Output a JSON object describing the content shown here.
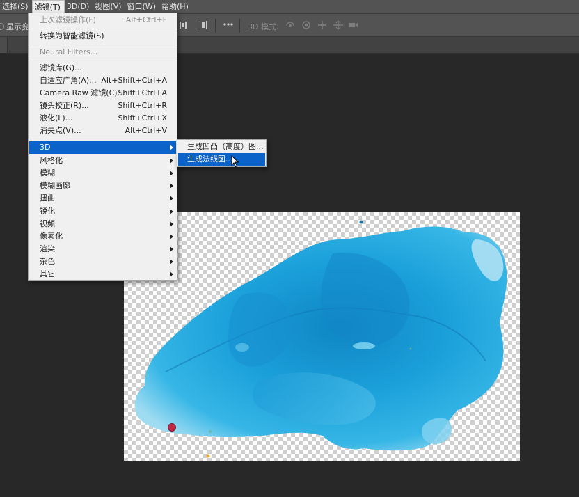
{
  "menubar": {
    "items": [
      {
        "label": "选择(S)"
      },
      {
        "label": "滤镜(T)",
        "active": true
      },
      {
        "label": "3D(D)"
      },
      {
        "label": "视图(V)"
      },
      {
        "label": "窗口(W)"
      },
      {
        "label": "帮助(H)"
      }
    ]
  },
  "options_bar": {
    "show_transform_label": "显示变",
    "mode_label": "3D 模式:",
    "more_icon": "ellipsis-icon",
    "icons": [
      "distribute-icon",
      "align-icon",
      "rotate-3d-icon",
      "roll-3d-icon",
      "drag-3d-icon",
      "slide-3d-icon",
      "scale-3d-icon"
    ]
  },
  "filter_menu": {
    "last_filter": {
      "label": "上次滤镜操作(F)",
      "shortcut": "Alt+Ctrl+F"
    },
    "convert_smart": {
      "label": "转换为智能滤镜(S)"
    },
    "neural": {
      "label": "Neural Filters..."
    },
    "items": [
      {
        "label": "滤镜库(G)...",
        "shortcut": ""
      },
      {
        "label": "自适应广角(A)...",
        "shortcut": "Alt+Shift+Ctrl+A"
      },
      {
        "label": "Camera Raw 滤镜(C)...",
        "shortcut": "Shift+Ctrl+A"
      },
      {
        "label": "镜头校正(R)...",
        "shortcut": "Shift+Ctrl+R"
      },
      {
        "label": "液化(L)...",
        "shortcut": "Shift+Ctrl+X"
      },
      {
        "label": "消失点(V)...",
        "shortcut": "Alt+Ctrl+V"
      }
    ],
    "submenus": [
      {
        "label": "3D",
        "highlighted": true
      },
      {
        "label": "风格化"
      },
      {
        "label": "模糊"
      },
      {
        "label": "模糊画廊"
      },
      {
        "label": "扭曲"
      },
      {
        "label": "锐化"
      },
      {
        "label": "视频"
      },
      {
        "label": "像素化"
      },
      {
        "label": "渲染"
      },
      {
        "label": "杂色"
      },
      {
        "label": "其它"
      }
    ]
  },
  "submenu_3d": {
    "items": [
      {
        "label": "生成凹凸（高度）图..."
      },
      {
        "label": "生成法线图...",
        "highlighted": true
      }
    ]
  },
  "colors": {
    "highlight": "#0b62c9",
    "menu_bg": "#f0f0f0",
    "workspace_bg": "#282828",
    "paint_blue": "#1e9fd8"
  }
}
